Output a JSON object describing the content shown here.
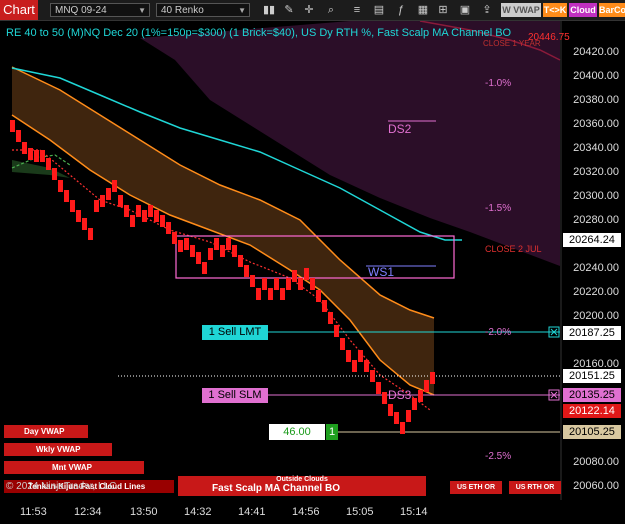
{
  "toolbar": {
    "chart_tab": "Chart",
    "instrument": "MNQ 09-24",
    "bar_type": "40 Renko",
    "btn_wvwap": "W VWAP",
    "btn_tk": "T<>K",
    "btn_cloud": "Cloud",
    "btn_barcolor": "BarCo"
  },
  "chart": {
    "title": "RE 40 to 50 (M)NQ Dec 20 (1%=150p=$300) (1 Brick=$40), US Dy RTH %, Fast Scalp MA Channel BO",
    "overlay_price": "20446.75",
    "close_high_label": "CLOSE 1 YEAR",
    "y_ticks": [
      "20420.00",
      "20400.00",
      "20380.00",
      "20360.00",
      "20340.00",
      "20320.00",
      "20300.00",
      "20280.00",
      "20240.00",
      "20220.00",
      "20200.00",
      "20160.00",
      "20080.00",
      "20060.00"
    ],
    "pct_labels": [
      "-1.0%",
      "-1.5%",
      "-2.0%",
      "-2.5%"
    ],
    "close_2_jul": "CLOSE 2 JUL",
    "ds2": "DS2",
    "ws1": "WS1",
    "ds3": "DS3",
    "sell_lmt": "1 Sell LMT",
    "sell_slm": "1 Sell SLM",
    "qty_value": "46.00",
    "qty_count": "1",
    "price_boxes": {
      "cyan_line": "20264.24",
      "sell_lmt": "20187.25",
      "last": "20151.25",
      "sell_slm": "20135.25",
      "red": "20122.14",
      "tan": "20105.25"
    },
    "x_ticks": [
      "11:53",
      "12:34",
      "13:50",
      "14:32",
      "14:41",
      "14:56",
      "15:05",
      "15:14"
    ],
    "buttons": {
      "day_vwap": "Day VWAP",
      "wkly_vwap": "Wkly VWAP",
      "mnt_vwap": "Mnt VWAP",
      "tenkan_kijun": "Tenkan-Kijun-Fast Cloud Lines",
      "outside_clouds": "Outside Clouds",
      "fast_scalp": "Fast Scalp MA Channel BO",
      "us_eth_or": "US ETH OR",
      "us_rth_or": "US RTH OR"
    },
    "copyright": "© 2024 NinjaTrader, LLC"
  },
  "colors": {
    "accent_red": "#c81e1e",
    "cyan": "#1fd6d6",
    "orange": "#ff8c1a",
    "magenta": "#e070d0",
    "dark_cloud": "#2a0f25"
  }
}
